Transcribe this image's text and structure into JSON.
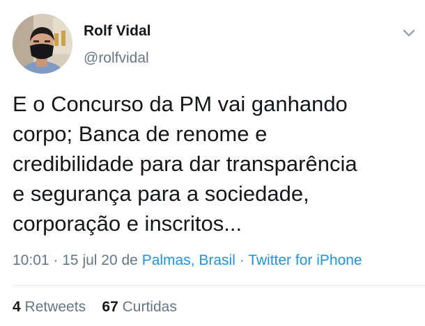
{
  "author": {
    "name": "Rolf Vidal",
    "handle": "@rolfvidal"
  },
  "tweet": {
    "lines": [
      "E o Concurso da PM vai ganhando",
      "corpo; Banca de renome e",
      "credibilidade para dar transparência",
      "e segurança para a sociedade,",
      "corporação e inscritos..."
    ],
    "time": "10:01",
    "date": "15 jul 20 de",
    "location": "Palmas, Brasil",
    "source": "Twitter for iPhone",
    "separator": "·"
  },
  "stats": {
    "retweets_count": "4",
    "retweets_label": "Retweets",
    "likes_count": "67",
    "likes_label": "Curtidas"
  },
  "icons": {
    "menu": "chevron-down-icon"
  },
  "colors": {
    "text": "#14171a",
    "secondary": "#657786",
    "link": "#1b95e0",
    "divider": "#e1e8ed"
  }
}
